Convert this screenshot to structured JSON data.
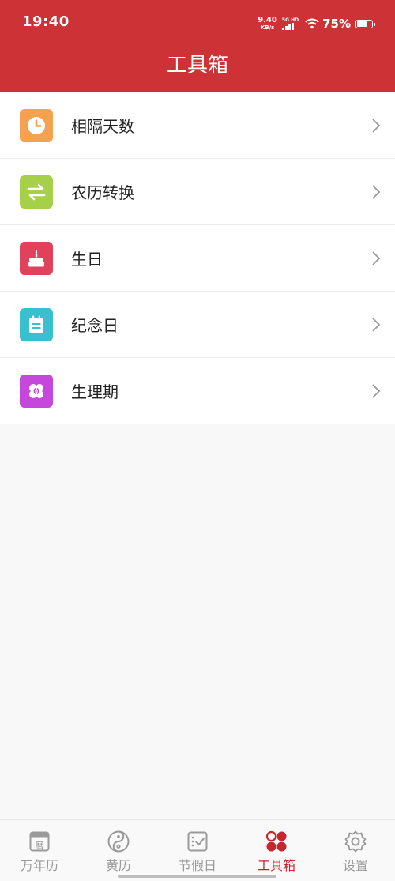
{
  "status_bar": {
    "time": "19:40",
    "net_speed": "9.40",
    "net_speed_unit": "KB/s",
    "network": "5G HD",
    "battery": "75%",
    "battery_level": 0.75
  },
  "header": {
    "title": "工具箱"
  },
  "tools": [
    {
      "label": "相隔天数",
      "icon": "clock-icon",
      "color": "#f4a24f"
    },
    {
      "label": "农历转换",
      "icon": "swap-arrows-icon",
      "color": "#a6cf4a"
    },
    {
      "label": "生日",
      "icon": "birthday-cake-icon",
      "color": "#e0415b"
    },
    {
      "label": "纪念日",
      "icon": "calendar-note-icon",
      "color": "#38c0cf"
    },
    {
      "label": "生理期",
      "icon": "period-icon",
      "color": "#c647dc"
    }
  ],
  "tabbar": {
    "items": [
      {
        "label": "万年历",
        "icon": "calendar-icon",
        "active": false
      },
      {
        "label": "黄历",
        "icon": "yin-yang-icon",
        "active": false
      },
      {
        "label": "节假日",
        "icon": "holiday-check-icon",
        "active": false
      },
      {
        "label": "工具箱",
        "icon": "toolbox-icon",
        "active": true
      },
      {
        "label": "设置",
        "icon": "gear-icon",
        "active": false
      }
    ]
  },
  "colors": {
    "header_bg": "#cc3236",
    "active_tab": "#c8262c",
    "inactive_tab": "#9a9a9a"
  }
}
